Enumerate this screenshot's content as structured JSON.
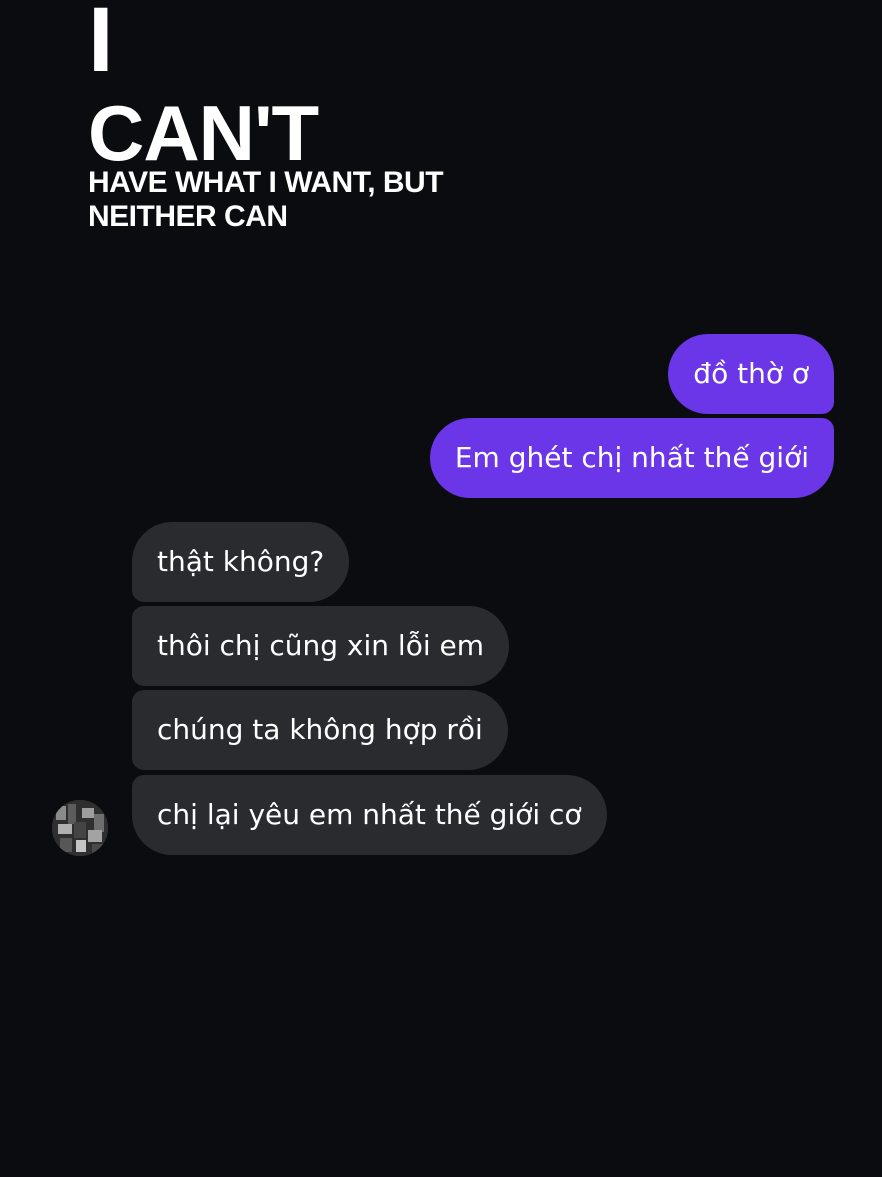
{
  "caption": {
    "line1": "I",
    "line2": "CAN'T",
    "line3": "HAVE WHAT I WANT, BUT",
    "line4": "NEITHER CAN"
  },
  "chat": {
    "outgoing": [
      "đồ thờ ơ",
      "Em ghét chị nhất thế giới"
    ],
    "incoming": [
      "thật không?",
      "thôi chị cũng xin lỗi em",
      "chúng ta không hợp rồi",
      "chị lại yêu em nhất thế giới cơ"
    ],
    "colors": {
      "background": "#0a0c10",
      "outgoing_bubble": "#6b35e8",
      "incoming_bubble": "#2a2b2f",
      "text": "#ffffff"
    }
  },
  "avatar": {
    "icon": "profile-photo-avatar"
  }
}
